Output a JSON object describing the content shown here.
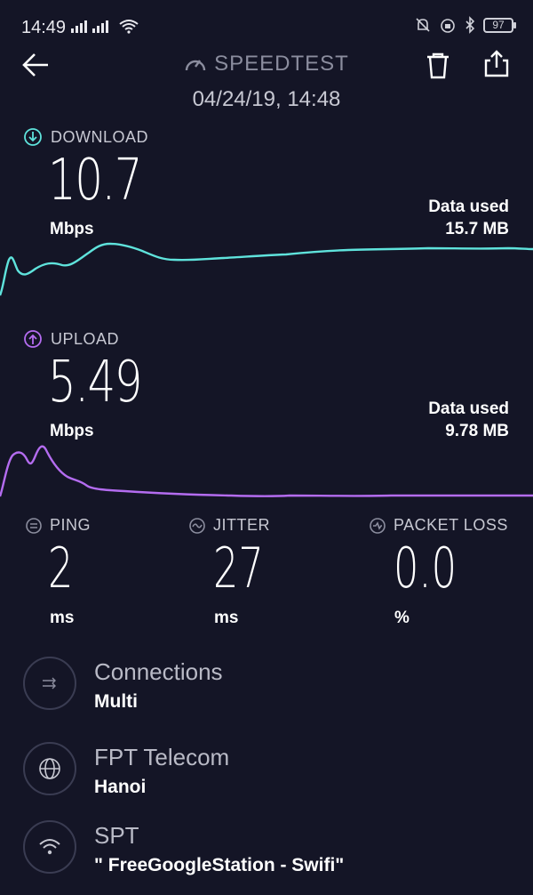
{
  "status_bar": {
    "time": "14:49",
    "battery": "97",
    "icons": [
      "signal-icon",
      "wifi-icon",
      "mute-icon",
      "alarm-icon",
      "bluetooth-icon",
      "battery-icon"
    ]
  },
  "header": {
    "title": "SPEEDTEST",
    "datetime": "04/24/19, 14:48"
  },
  "download": {
    "label": "DOWNLOAD",
    "value": "10.7",
    "unit": "Mbps",
    "data_used_label": "Data used",
    "data_used_value": "15.7 MB",
    "color": "#5fe3dc"
  },
  "upload": {
    "label": "UPLOAD",
    "value": "5.49",
    "unit": "Mbps",
    "data_used_label": "Data used",
    "data_used_value": "9.78 MB",
    "color": "#b46cf0"
  },
  "metrics": [
    {
      "label": "PING",
      "value": "2",
      "unit": "ms"
    },
    {
      "label": "JITTER",
      "value": "27",
      "unit": "ms"
    },
    {
      "label": "PACKET LOSS",
      "value": "0.0",
      "unit": "%"
    }
  ],
  "info": [
    {
      "title": "Connections",
      "subtitle": "Multi",
      "icon": "connections-icon"
    },
    {
      "title": "FPT Telecom",
      "subtitle": "Hanoi",
      "icon": "globe-icon"
    },
    {
      "title": "SPT",
      "subtitle": "\" FreeGoogleStation - Swifi\"",
      "icon": "wifi-icon"
    }
  ]
}
